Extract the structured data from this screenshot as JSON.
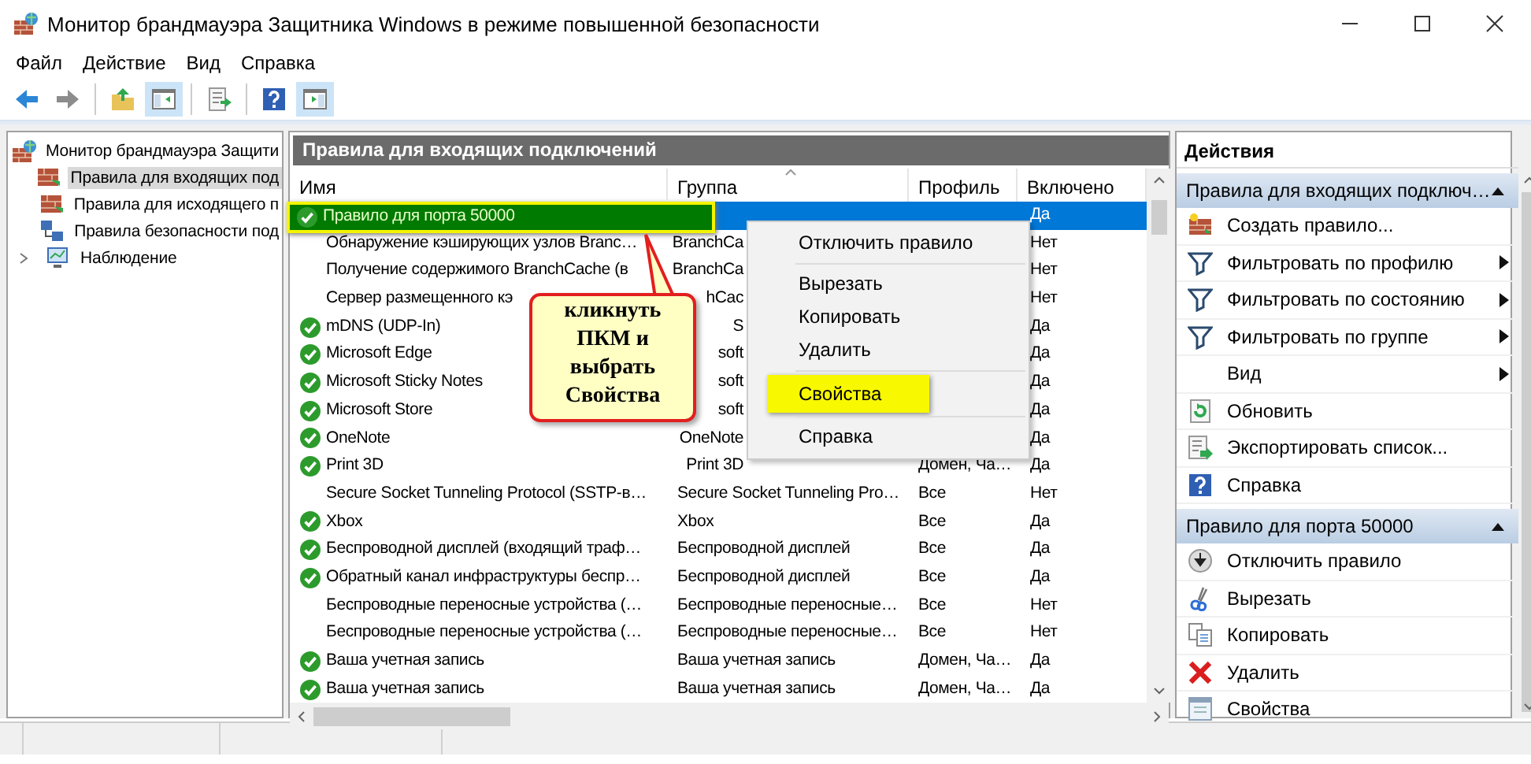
{
  "window": {
    "title": "Монитор брандмауэра Защитника Windows в режиме повышенной безопасности"
  },
  "menu": [
    "Файл",
    "Действие",
    "Вид",
    "Справка"
  ],
  "toolbar": [
    {
      "pressed": false
    },
    {
      "pressed": false
    },
    {
      "pressed": false
    },
    {
      "pressed": true
    },
    {
      "pressed": false
    },
    {
      "pressed": false
    },
    {
      "pressed": true
    }
  ],
  "tree": {
    "label": "Монитор брандмауэра Защити",
    "children": [
      {
        "label": "Правила для входящих под",
        "selected": true
      },
      {
        "label": "Правила для исходящего п",
        "selected": false
      },
      {
        "label": "Правила безопасности под",
        "selected": false
      },
      {
        "label": "Наблюдение",
        "selected": false,
        "expanded": false
      }
    ]
  },
  "rules_panel": {
    "title": "Правила для входящих подключений",
    "columns": [
      "Имя",
      "Группа",
      "Профиль",
      "Включено"
    ],
    "rows": [
      {
        "name": "Правило для порта 50000",
        "enabled": "Да",
        "active": true,
        "selected": true,
        "highlighted": true
      },
      {
        "name": "Обнаружение кэширующих узлов Branc…",
        "group": "BranchCa",
        "enabled": "Нет",
        "active": false,
        "selected": false,
        "highlighted": false
      },
      {
        "name": "Получение содержимого BranchCache (в",
        "group": "BranchCa",
        "enabled": "Нет",
        "active": false,
        "selected": false,
        "highlighted": false
      },
      {
        "name": "Сервер размещенного кэ",
        "group": "hCac",
        "enabled": "Нет",
        "active": false,
        "selected": false,
        "highlighted": false
      },
      {
        "name": "mDNS (UDP-In)",
        "group": "S",
        "enabled": "Да",
        "active": true,
        "selected": false,
        "highlighted": false
      },
      {
        "name": "Microsoft Edge",
        "group": "soft",
        "enabled": "Да",
        "active": true,
        "selected": false,
        "highlighted": false
      },
      {
        "name": "Microsoft Sticky Notes",
        "group": "soft",
        "enabled": "Да",
        "active": true,
        "selected": false,
        "highlighted": false
      },
      {
        "name": "Microsoft Store",
        "group": "soft",
        "enabled": "Да",
        "active": true,
        "selected": false,
        "highlighted": false
      },
      {
        "name": "OneNote",
        "group": "OneNote",
        "enabled": "Да",
        "active": true,
        "selected": false,
        "highlighted": false
      },
      {
        "name": "Print 3D",
        "group": "Print 3D",
        "profile": "Домен, Ча…",
        "enabled": "Да",
        "active": true,
        "selected": false,
        "highlighted": false
      },
      {
        "name": "Secure Socket Tunneling Protocol (SSTP-в…",
        "group": "Secure Socket Tunneling Pro…",
        "profile": "Все",
        "enabled": "Нет",
        "active": false,
        "selected": false,
        "highlighted": false
      },
      {
        "name": "Xbox",
        "group": "Xbox",
        "profile": "Все",
        "enabled": "Да",
        "active": true,
        "selected": false,
        "highlighted": false
      },
      {
        "name": "Беспроводной дисплей (входящий траф…",
        "group": "Беспроводной дисплей",
        "profile": "Все",
        "enabled": "Да",
        "active": true,
        "selected": false,
        "highlighted": false
      },
      {
        "name": "Обратный канал инфраструктуры беспр…",
        "group": "Беспроводной дисплей",
        "profile": "Все",
        "enabled": "Да",
        "active": true,
        "selected": false,
        "highlighted": false
      },
      {
        "name": "Беспроводные переносные устройства (…",
        "group": "Беспроводные переносные…",
        "profile": "Все",
        "enabled": "Нет",
        "active": false,
        "selected": false,
        "highlighted": false
      },
      {
        "name": "Беспроводные переносные устройства (…",
        "group": "Беспроводные переносные…",
        "profile": "Все",
        "enabled": "Нет",
        "active": false,
        "selected": false,
        "highlighted": false
      },
      {
        "name": "Ваша учетная запись",
        "group": "Ваша учетная запись",
        "profile": "Домен, Ча…",
        "enabled": "Да",
        "active": true,
        "selected": false,
        "highlighted": false
      },
      {
        "name": "Ваша учетная запись",
        "group": "Ваша учетная запись",
        "profile": "Домен, Ча…",
        "enabled": "Да",
        "active": true,
        "selected": false,
        "highlighted": false
      }
    ]
  },
  "context_menu": [
    {
      "kind": "item",
      "label": "Отключить правило",
      "highlighted": false
    },
    {
      "kind": "separator"
    },
    {
      "kind": "item",
      "label": "Вырезать",
      "highlighted": false
    },
    {
      "kind": "item",
      "label": "Копировать",
      "highlighted": false
    },
    {
      "kind": "item",
      "label": "Удалить",
      "highlighted": false
    },
    {
      "kind": "separator"
    },
    {
      "kind": "item",
      "label": "Свойства",
      "highlighted": true
    },
    {
      "kind": "separator"
    },
    {
      "kind": "item",
      "label": "Справка",
      "highlighted": false
    }
  ],
  "callout": {
    "text": "кликнуть\nПКМ и\nвыбрать\nСвойства"
  },
  "actions": {
    "title": "Действия",
    "sections": [
      {
        "title": "Правила для входящих подключ…",
        "expanded": true,
        "items": [
          {
            "label": "Создать правило...",
            "submenu": false
          },
          {
            "label": "Фильтровать по профилю",
            "submenu": true
          },
          {
            "label": "Фильтровать по состоянию",
            "submenu": true
          },
          {
            "label": "Фильтровать по группе",
            "submenu": true
          },
          {
            "label": "Вид",
            "submenu": true
          },
          {
            "label": "Обновить",
            "submenu": false
          },
          {
            "label": "Экспортировать список...",
            "submenu": false
          },
          {
            "label": "Справка",
            "submenu": false
          }
        ]
      },
      {
        "title": "Правило для порта 50000",
        "expanded": true,
        "items": [
          {
            "label": "Отключить правило",
            "submenu": false
          },
          {
            "label": "Вырезать",
            "submenu": false
          },
          {
            "label": "Копировать",
            "submenu": false
          },
          {
            "label": "Удалить",
            "submenu": false
          },
          {
            "label": "Свойства",
            "submenu": false
          }
        ]
      }
    ]
  }
}
